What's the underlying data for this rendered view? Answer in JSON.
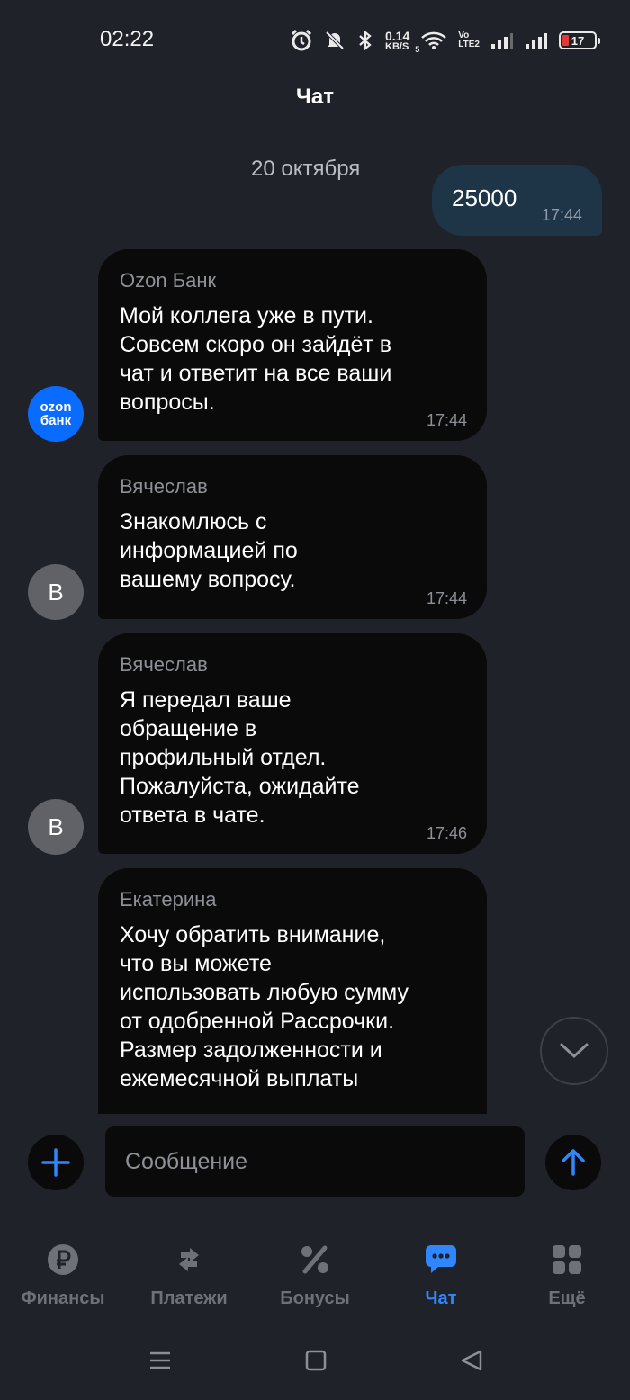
{
  "status_bar": {
    "time": "02:22",
    "net_speed_value": "0.14",
    "net_speed_unit": "KB/S",
    "wifi_badge": "5",
    "volte_top": "Vo",
    "volte_bottom": "LTE2",
    "battery_percent": "17",
    "battery_color": "#e53935"
  },
  "header": {
    "title": "Чат"
  },
  "chat": {
    "date_separator": "20 октября",
    "outgoing": {
      "text": "25000",
      "time": "17:44"
    },
    "messages": [
      {
        "sender": "Ozon Банк",
        "text": "Мой коллега уже в пути. Совсем скоро он зайдёт в чат и ответит на все ваши вопросы.",
        "time": "17:44",
        "avatar": "ozon-logo"
      },
      {
        "sender": "Вячеслав",
        "text": "Знакомлюсь с информацией по вашему вопросу.",
        "time": "17:44",
        "avatar": "В"
      },
      {
        "sender": "Вячеслав",
        "text": "Я передал ваше обращение в профильный отдел. Пожалуйста, ожидайте ответа в чате.",
        "time": "17:46",
        "avatar": "В"
      },
      {
        "sender": "Екатерина",
        "text": "Хочу обратить внимание, что вы можете использовать любую сумму от одобренной Рассрочки. Размер задолженности и ежемесячной выплаты",
        "time": ""
      }
    ],
    "ozon_logo_line1": "ozon",
    "ozon_logo_line2": "банк",
    "accent_color": "#2f86ff"
  },
  "composer": {
    "placeholder": "Сообщение"
  },
  "bottom_nav": {
    "items": [
      {
        "label": "Финансы",
        "icon": "ruble-icon"
      },
      {
        "label": "Платежи",
        "icon": "transfer-arrows-icon"
      },
      {
        "label": "Бонусы",
        "icon": "percent-icon"
      },
      {
        "label": "Чат",
        "icon": "chat-bubble-icon",
        "active": true
      },
      {
        "label": "Ещё",
        "icon": "grid-icon"
      }
    ]
  }
}
